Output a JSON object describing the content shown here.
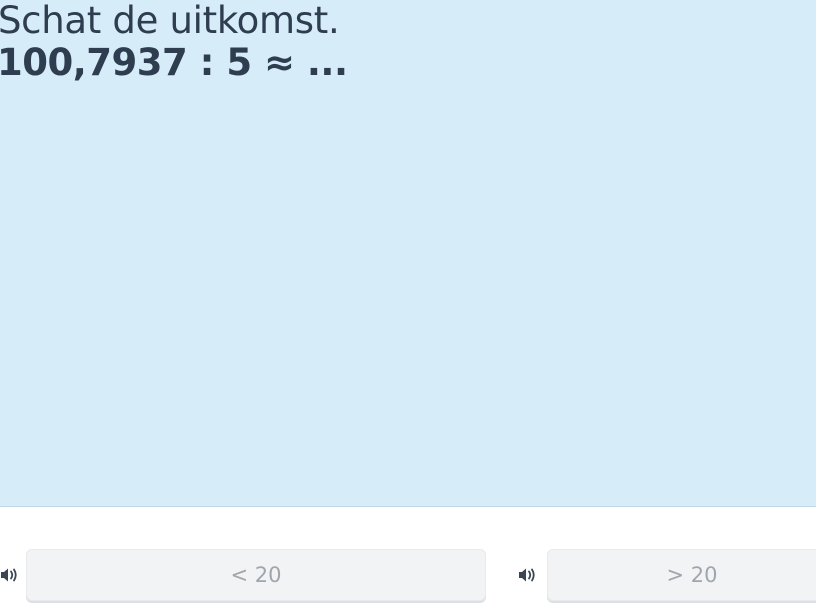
{
  "question": {
    "prompt": "Schat de uitkomst.",
    "expression": "100,7937 : 5 ≈ ..."
  },
  "answers": [
    {
      "label": "< 20",
      "audio_icon": "speaker-icon"
    },
    {
      "label": "> 20",
      "audio_icon": "speaker-icon"
    }
  ],
  "colors": {
    "panel_background": "#d6ecf9",
    "text": "#2e3d4f",
    "option_background": "#f2f3f5",
    "option_text": "#a0a6ae",
    "icon": "#3a4654"
  }
}
